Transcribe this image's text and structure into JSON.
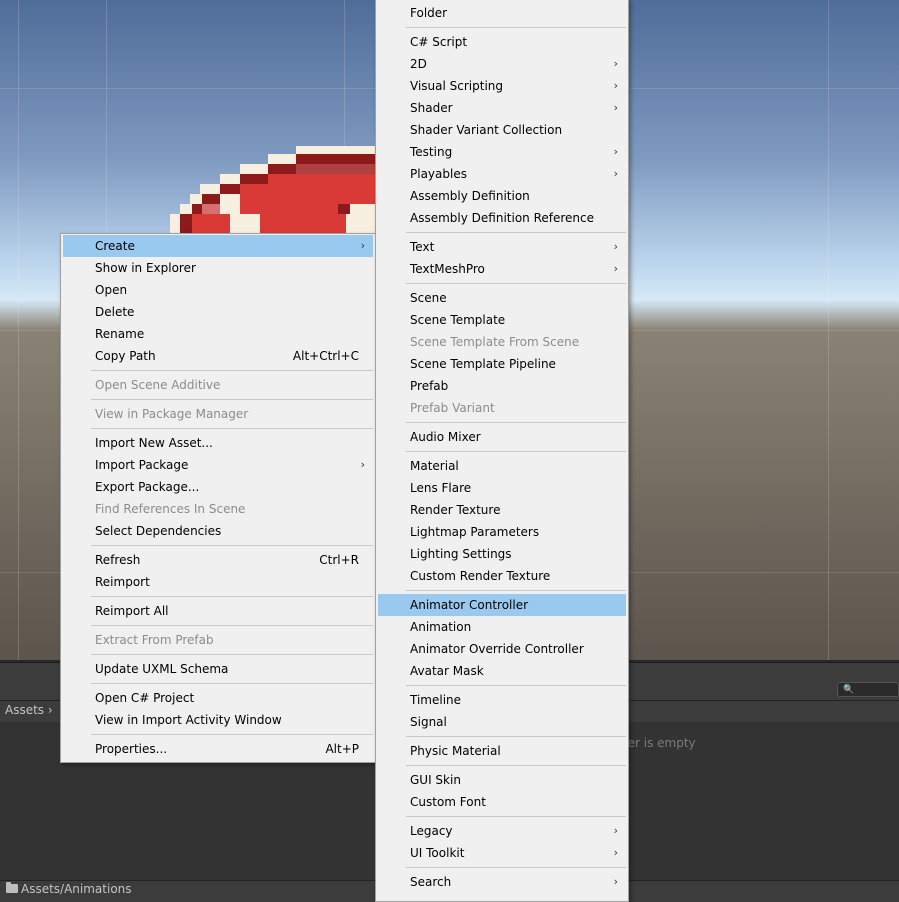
{
  "project": {
    "breadcrumb": "Assets",
    "empty_message": "der is empty",
    "path": "Assets/Animations",
    "search_placeholder": "🔍"
  },
  "context_menu": {
    "items": [
      {
        "label": "Create",
        "submenu": true,
        "highlight": true
      },
      {
        "label": "Show in Explorer"
      },
      {
        "label": "Open"
      },
      {
        "label": "Delete"
      },
      {
        "label": "Rename"
      },
      {
        "label": "Copy Path",
        "shortcut": "Alt+Ctrl+C"
      },
      {
        "separator": true
      },
      {
        "label": "Open Scene Additive",
        "disabled": true
      },
      {
        "separator": true
      },
      {
        "label": "View in Package Manager",
        "disabled": true
      },
      {
        "separator": true
      },
      {
        "label": "Import New Asset..."
      },
      {
        "label": "Import Package",
        "submenu": true
      },
      {
        "label": "Export Package..."
      },
      {
        "label": "Find References In Scene",
        "disabled": true
      },
      {
        "label": "Select Dependencies"
      },
      {
        "separator": true
      },
      {
        "label": "Refresh",
        "shortcut": "Ctrl+R"
      },
      {
        "label": "Reimport"
      },
      {
        "separator": true
      },
      {
        "label": "Reimport All"
      },
      {
        "separator": true
      },
      {
        "label": "Extract From Prefab",
        "disabled": true
      },
      {
        "separator": true
      },
      {
        "label": "Update UXML Schema"
      },
      {
        "separator": true
      },
      {
        "label": "Open C# Project"
      },
      {
        "label": "View in Import Activity Window"
      },
      {
        "separator": true
      },
      {
        "label": "Properties...",
        "shortcut": "Alt+P"
      }
    ]
  },
  "create_menu": {
    "items": [
      {
        "label": "Folder"
      },
      {
        "separator": true
      },
      {
        "label": "C# Script"
      },
      {
        "label": "2D",
        "submenu": true
      },
      {
        "label": "Visual Scripting",
        "submenu": true
      },
      {
        "label": "Shader",
        "submenu": true
      },
      {
        "label": "Shader Variant Collection"
      },
      {
        "label": "Testing",
        "submenu": true
      },
      {
        "label": "Playables",
        "submenu": true
      },
      {
        "label": "Assembly Definition"
      },
      {
        "label": "Assembly Definition Reference"
      },
      {
        "separator": true
      },
      {
        "label": "Text",
        "submenu": true
      },
      {
        "label": "TextMeshPro",
        "submenu": true
      },
      {
        "separator": true
      },
      {
        "label": "Scene"
      },
      {
        "label": "Scene Template"
      },
      {
        "label": "Scene Template From Scene",
        "disabled": true
      },
      {
        "label": "Scene Template Pipeline"
      },
      {
        "label": "Prefab"
      },
      {
        "label": "Prefab Variant",
        "disabled": true
      },
      {
        "separator": true
      },
      {
        "label": "Audio Mixer"
      },
      {
        "separator": true
      },
      {
        "label": "Material"
      },
      {
        "label": "Lens Flare"
      },
      {
        "label": "Render Texture"
      },
      {
        "label": "Lightmap Parameters"
      },
      {
        "label": "Lighting Settings"
      },
      {
        "label": "Custom Render Texture"
      },
      {
        "separator": true
      },
      {
        "label": "Animator Controller",
        "highlight": true
      },
      {
        "label": "Animation"
      },
      {
        "label": "Animator Override Controller"
      },
      {
        "label": "Avatar Mask"
      },
      {
        "separator": true
      },
      {
        "label": "Timeline"
      },
      {
        "label": "Signal"
      },
      {
        "separator": true
      },
      {
        "label": "Physic Material"
      },
      {
        "separator": true
      },
      {
        "label": "GUI Skin"
      },
      {
        "label": "Custom Font"
      },
      {
        "separator": true
      },
      {
        "label": "Legacy",
        "submenu": true
      },
      {
        "label": "UI Toolkit",
        "submenu": true
      },
      {
        "separator": true
      },
      {
        "label": "Search",
        "submenu": true
      }
    ]
  },
  "icons": {
    "submenu_arrow": "›"
  },
  "colors": {
    "highlight": "#99c9ef",
    "menu_bg": "#f0f0f0",
    "disabled_text": "#8c8c8c"
  }
}
